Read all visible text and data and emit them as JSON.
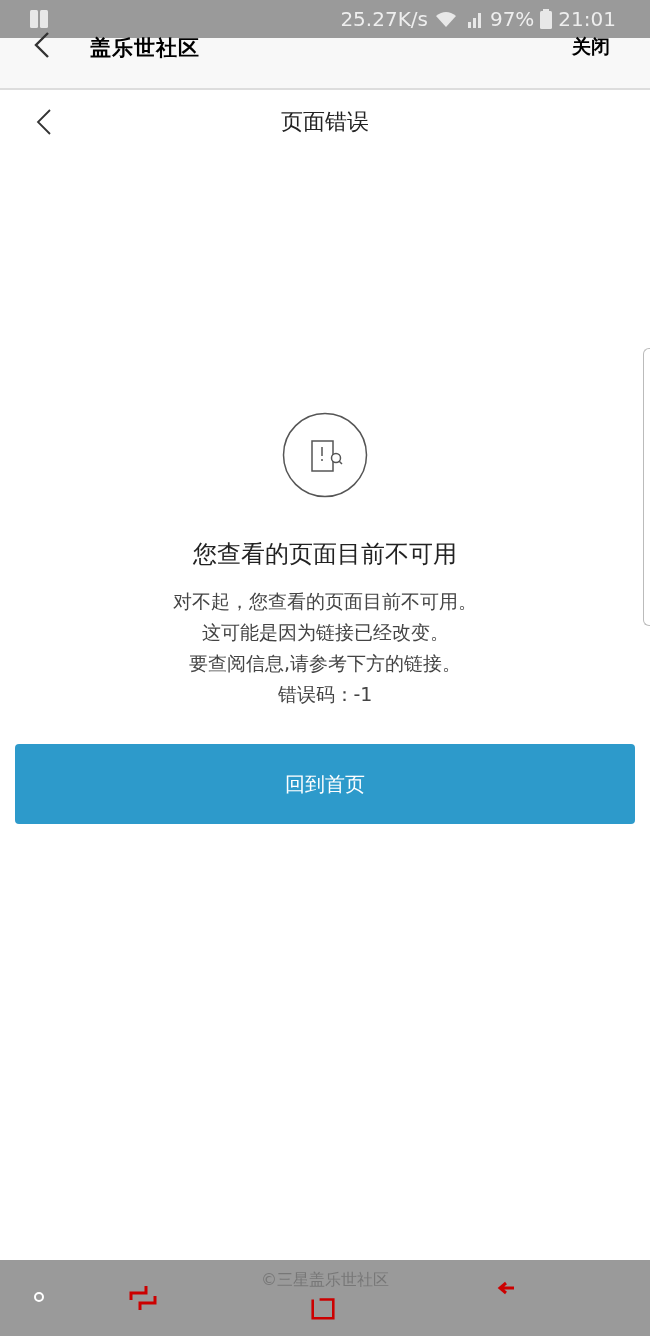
{
  "status_bar": {
    "speed": "25.27K/s",
    "battery": "97%",
    "time": "21:01"
  },
  "app_bar": {
    "title": "盖乐世社区",
    "close": "关闭"
  },
  "page_header": {
    "title": "页面错误"
  },
  "error": {
    "heading": "您查看的页面目前不可用",
    "lines": [
      "对不起，您查看的页面目前不可用。",
      "这可能是因为链接已经改变。",
      "要查阅信息,请参考下方的链接。",
      "错误码：-1"
    ]
  },
  "home_button": "回到首页",
  "footer": "©三星盖乐世社区"
}
